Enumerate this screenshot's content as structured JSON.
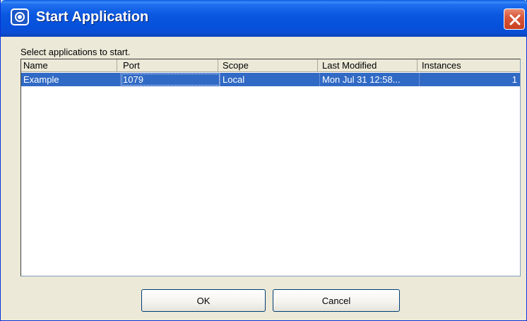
{
  "window": {
    "title": "Start Application"
  },
  "dialog": {
    "prompt": "Select applications to start."
  },
  "table": {
    "columns": [
      "Name",
      "Port",
      "Scope",
      "Last Modified",
      "Instances"
    ],
    "rows": [
      {
        "name": "Example",
        "port": "1079",
        "scope": "Local",
        "last_modified": "Mon Jul 31 12:58...",
        "instances": "1",
        "selected": true
      }
    ]
  },
  "buttons": {
    "ok_label": "OK",
    "cancel_label": "Cancel"
  },
  "colors": {
    "titlebar": "#0b58e0",
    "selection": "#316ac5",
    "close": "#d8573b"
  },
  "icons": [
    "app-icon",
    "close-icon"
  ]
}
